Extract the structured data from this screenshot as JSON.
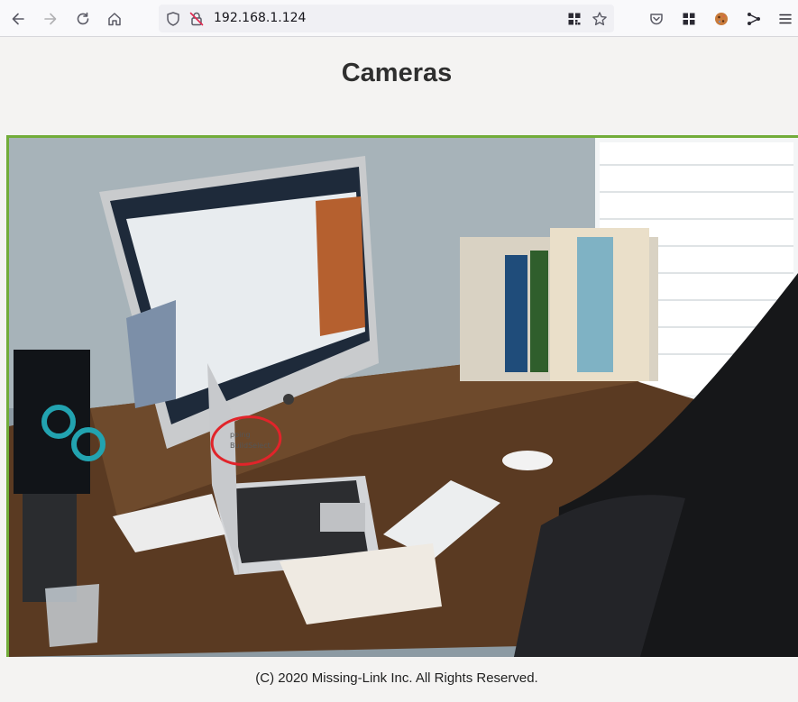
{
  "browser": {
    "url": "192.168.1.124",
    "icons": {
      "back": "arrow-left-icon",
      "forward": "arrow-right-icon",
      "reload": "reload-icon",
      "home": "home-icon",
      "tracking": "shield-icon",
      "insecure": "insecure-lock-icon",
      "qr": "qr-code-icon",
      "bookmark": "star-icon",
      "pocket": "pocket-icon",
      "extensions": "extensions-icon",
      "cookie": "cookie-icon",
      "share": "share-icon",
      "menu": "hamburger-menu-icon"
    }
  },
  "page": {
    "title": "Cameras",
    "camera_feed": {
      "alt": "camera feed",
      "border_color": "#72ac3a",
      "annotation_text_line1": "pping",
      "annotation_text_line2": "BuildSelect"
    },
    "footer": "(C) 2020 Missing-Link Inc. All Rights Reserved."
  }
}
